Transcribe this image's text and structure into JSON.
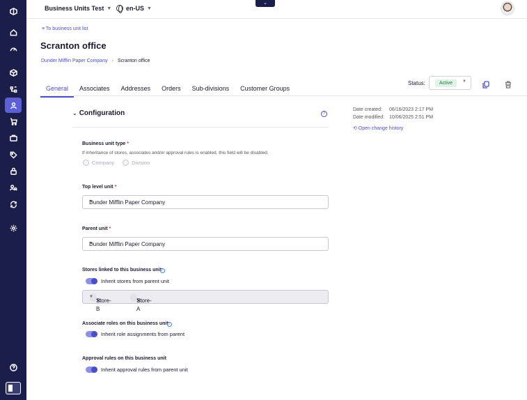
{
  "sidebar": {
    "items": [
      "logo-icon",
      "home-icon",
      "gauge-icon",
      "box-icon",
      "hierarchy-icon",
      "user-icon",
      "cart-icon",
      "media-icon",
      "tag-icon",
      "lock-icon",
      "users-search-icon",
      "sync-icon",
      "settings-icon",
      "help-icon",
      "panel-toggle-icon"
    ],
    "active": "user-icon"
  },
  "topbar": {
    "project": "Business Units Test",
    "locale": "en-US",
    "center_tab": "⌄"
  },
  "page": {
    "back_link": "≡ To business unit list",
    "title": "Scranton office",
    "breadcrumb_parent": "Dunder Mifflin Paper Company",
    "breadcrumb_sep": "›",
    "breadcrumb_current": "Scranton office"
  },
  "status": {
    "label": "Status:",
    "value": "Active",
    "value_color": "#1e7a42"
  },
  "tabs": [
    {
      "label": "General",
      "active": true
    },
    {
      "label": "Associates"
    },
    {
      "label": "Addresses"
    },
    {
      "label": "Orders"
    },
    {
      "label": "Sub-divisions"
    },
    {
      "label": "Customer Groups"
    }
  ],
  "section": {
    "title": "Configuration",
    "help": "?"
  },
  "meta": {
    "created_label": "Date created:",
    "created_value": "06/16/2023 2:17 PM",
    "modified_label": "Date modified:",
    "modified_value": "10/06/2025 2:51 PM",
    "history_link": "⟲ Open change history"
  },
  "form": {
    "unit_type_label": "Business unit type",
    "required": "*",
    "unit_type_hint": "If inheritance of stores, associates and/or approval rules is enabled, this field will be disabled.",
    "radio_company": "Company",
    "radio_division": "Division",
    "top_level_label": "Top level unit",
    "top_level_value": "Dunder Mifflin Paper Company",
    "parent_label": "Parent unit",
    "parent_value": "Dunder Mifflin Paper Company",
    "stores_label": "Stores linked to this business unit",
    "stores_toggle": "Inherit stores from parent unit",
    "stores": [
      "Store-B",
      "Store-A"
    ],
    "chip_remove": "✕",
    "roles_label": "Associate roles on this business unit",
    "roles_toggle": "Inherit role assignments from parent",
    "approval_label": "Approval rules on this business unit",
    "approval_toggle": "Inherit approval rules from parent unit",
    "info": "i",
    "caret": "▼"
  },
  "colors": {
    "sidebar": "#1b1e4b",
    "accent": "#4b4fc7"
  }
}
